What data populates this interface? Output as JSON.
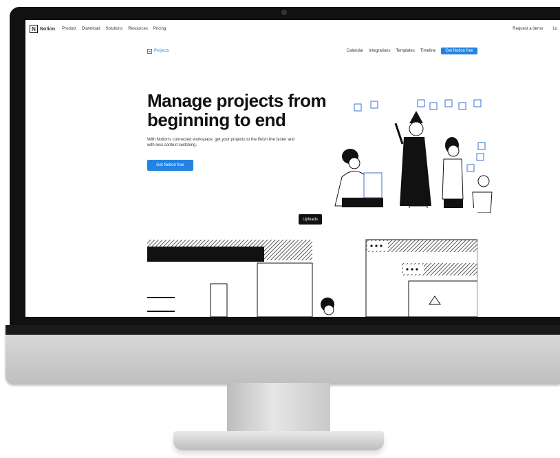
{
  "nav": {
    "logo": "Notion",
    "menu": [
      "Product",
      "Download",
      "Solutions",
      "Resources",
      "Pricing"
    ],
    "right": [
      "Request a demo",
      "Lo"
    ]
  },
  "subnav": {
    "brand": "Projects",
    "links": [
      "Calendar",
      "Integrations",
      "Templates",
      "Timeline"
    ],
    "cta": "Get Notion free"
  },
  "hero": {
    "headline": "Manage projects from beginning to end",
    "subtext": "With Notion's connected workspace, get your projects to the finish line faster and with less context switching.",
    "cta": "Get Notion free"
  },
  "pill": "Uploads",
  "colors": {
    "accent": "#2383e2",
    "bezel": "#111111"
  }
}
